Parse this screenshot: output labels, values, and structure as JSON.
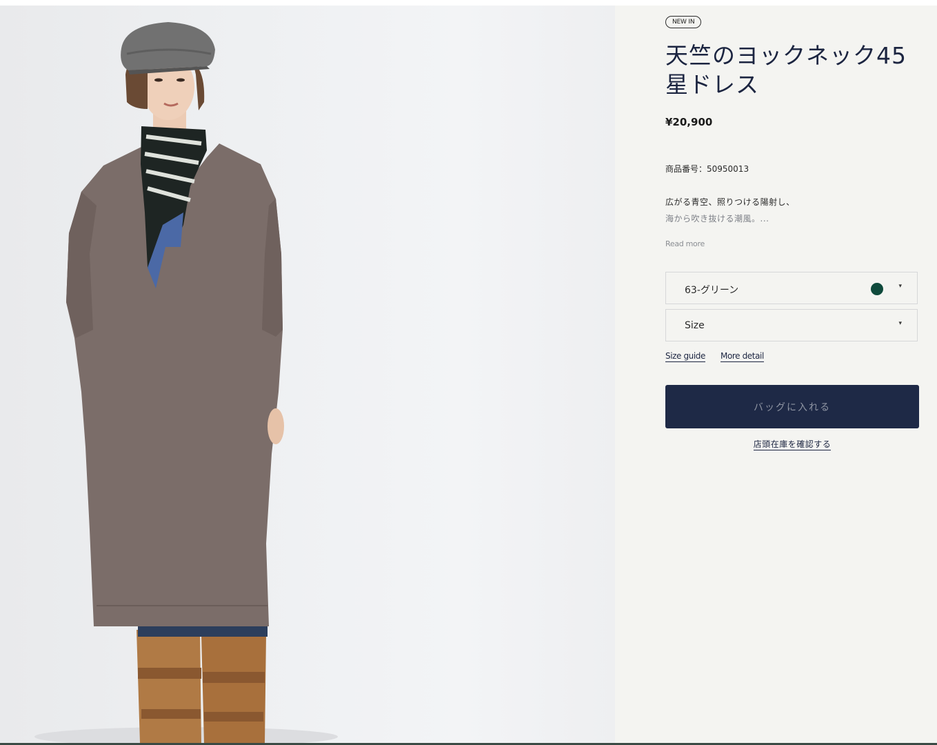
{
  "product": {
    "badge": "NEW IN",
    "title": "天竺のヨックネック45星ドレス",
    "price": "¥20,900",
    "sku": "商品番号：50950013",
    "description_line1": "広がる青空、照りつける陽射し、",
    "description_line2": "海から吹き抜ける潮風。...",
    "read_more": "Read more"
  },
  "options": {
    "color_value": "63-グリーン",
    "color_swatch": "#0f4a3c",
    "size_placeholder": "Size",
    "caret_icon": "▾"
  },
  "links": {
    "size_guide": "Size guide",
    "more_detail": "More detail"
  },
  "actions": {
    "add_to_bag": "バッグに入れる",
    "check_store_stock": "店頭在庫を確認する"
  },
  "colors": {
    "navy": "#1e2946",
    "background": "#f4f4f1"
  }
}
